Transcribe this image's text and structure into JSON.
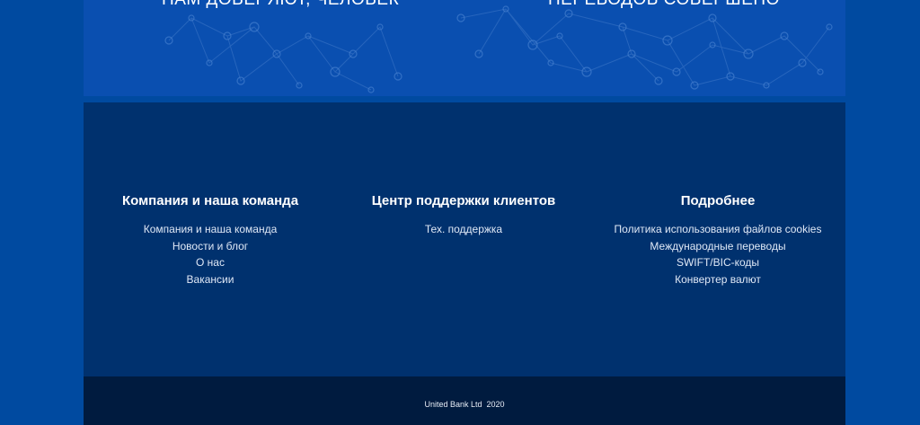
{
  "stats": {
    "left_caption": "НАМ ДОВЕРЯЮТ, ЧЕЛОВЕК",
    "right_caption": "ПЕРЕВОДОВ СОВЕРШЕНО"
  },
  "footer": {
    "columns": [
      {
        "title": "Компания и наша команда",
        "links": [
          "Компания и наша команда",
          "Новости и блог",
          "О нас",
          "Вакансии"
        ]
      },
      {
        "title": "Центр поддержки клиентов",
        "links": [
          "Тех. поддержка"
        ]
      },
      {
        "title": "Подробнее",
        "links": [
          "Политика использования файлов cookies",
          "Международные переводы",
          "SWIFT/BIC-коды",
          "Конвертер валют"
        ]
      }
    ],
    "copyright": "United Bank Ltd  2020"
  },
  "colors": {
    "page_bg": "#004aa0",
    "stats_band": "#0a4fb0",
    "footer_main": "#00316e",
    "footer_bottom": "#001b3f"
  }
}
